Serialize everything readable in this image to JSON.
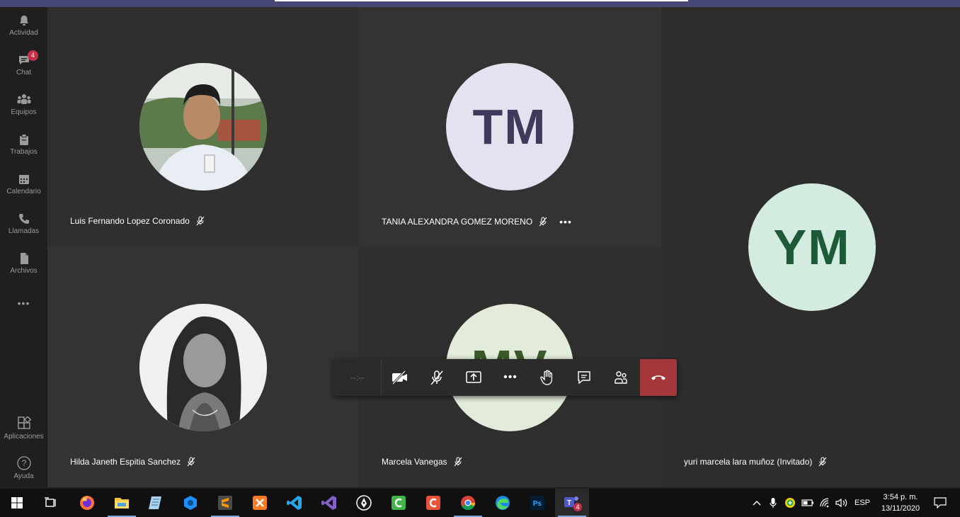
{
  "rail": {
    "items": [
      {
        "label": "Actividad",
        "icon": "bell-icon"
      },
      {
        "label": "Chat",
        "icon": "chat-icon",
        "badge": "4"
      },
      {
        "label": "Equipos",
        "icon": "teams-icon"
      },
      {
        "label": "Trabajos",
        "icon": "assignments-icon"
      },
      {
        "label": "Calendario",
        "icon": "calendar-icon"
      },
      {
        "label": "Llamadas",
        "icon": "phone-icon"
      },
      {
        "label": "Archivos",
        "icon": "files-icon"
      }
    ],
    "more_label": "•••",
    "apps_label": "Aplicaciones",
    "help_label": "Ayuda"
  },
  "participants": [
    {
      "name": "Luis Fernando Lopez Coronado",
      "avatar": "photo"
    },
    {
      "name": "TANIA ALEXANDRA GOMEZ MORENO",
      "initials": "TM",
      "bg": "#e5e1f1",
      "fg": "#3d3a5c"
    },
    {
      "name": "yuri marcela lara muñoz (Invitado)",
      "initials": "YM",
      "bg": "#d4ebdf",
      "fg": "#1e5a38"
    },
    {
      "name": "Hilda Janeth Espitia Sanchez",
      "avatar": "photo"
    },
    {
      "name": "Marcela Vanegas",
      "initials": "MV",
      "bg": "#e3ecda",
      "fg": "#3b5a2a"
    }
  ],
  "more_options": "•••",
  "callbar": {
    "timer": "--:--",
    "buttons": [
      "camera-off-icon",
      "mic-off-icon",
      "share-screen-icon",
      "more-icon",
      "raise-hand-icon",
      "conversation-icon",
      "participants-icon",
      "hang-up-icon"
    ]
  },
  "taskbar": {
    "lang": "ESP",
    "time": "3:54 p. m.",
    "date": "13/11/2020",
    "teams_badge": "4"
  },
  "colors": {
    "teams_purple": "#464775",
    "hangup_red": "#a4373a",
    "badge_red": "#c4314b"
  }
}
